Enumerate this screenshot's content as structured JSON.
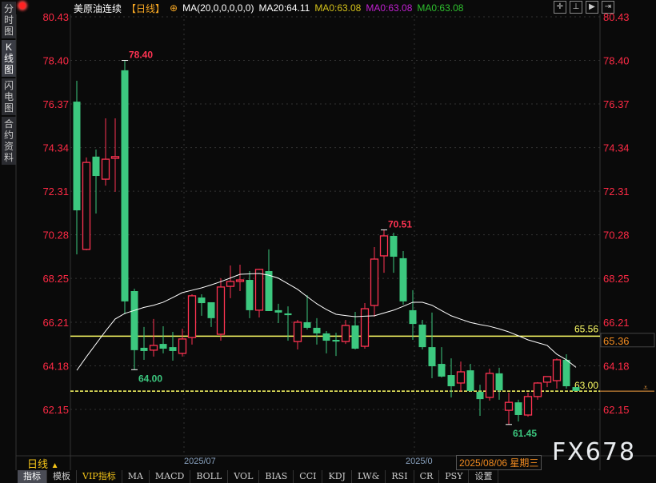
{
  "sidebar": {
    "tabs": [
      {
        "label": "分时图",
        "active": false
      },
      {
        "label": "K线图",
        "active": true
      },
      {
        "label": "闪电图",
        "active": false
      },
      {
        "label": "合约资料",
        "active": false
      }
    ]
  },
  "header": {
    "title": "美原油连续",
    "period": "【日线】",
    "ma_params": "MA(20,0,0,0,0,0)",
    "ma20": "MA20:64.11",
    "ma0_a": "MA0:63.08",
    "ma0_b": "MA0:63.08",
    "ma0_c": "MA0:63.08"
  },
  "colors": {
    "up": "#ff3352",
    "down": "#3cc87f",
    "ma20": "#ffffff",
    "ma0_a": "#d4c21a",
    "ma0_b": "#c020d0",
    "ma0_c": "#2ec02e",
    "hline": "#ffff66",
    "cursor_line": "#f5a040",
    "axis": "#ff2a45"
  },
  "toolbar_icons": [
    "crosshair-icon",
    "interval-icon",
    "play-icon",
    "forward-icon"
  ],
  "y_axis": {
    "ticks": [
      80.43,
      78.4,
      76.37,
      74.34,
      72.31,
      70.28,
      68.25,
      66.21,
      64.18,
      62.15
    ]
  },
  "chart_data": {
    "type": "candlestick",
    "ylim": [
      62.15,
      80.43
    ],
    "candles": [
      [
        76.48,
        77.45,
        69.37,
        71.42
      ],
      [
        69.6,
        73.88,
        69.56,
        73.65
      ],
      [
        73.92,
        74.25,
        71.27,
        73.02
      ],
      [
        72.87,
        75.7,
        72.57,
        73.8
      ],
      [
        73.84,
        75.7,
        72.28,
        73.92
      ],
      [
        77.94,
        78.4,
        66.58,
        67.18
      ],
      [
        67.66,
        67.77,
        64.0,
        64.91
      ],
      [
        65.02,
        65.99,
        64.46,
        64.87
      ],
      [
        64.91,
        66.36,
        64.61,
        65.13
      ],
      [
        65.2,
        66.02,
        64.76,
        64.98
      ],
      [
        65.05,
        65.76,
        64.42,
        64.87
      ],
      [
        64.76,
        65.91,
        64.61,
        65.43
      ],
      [
        65.5,
        67.51,
        65.17,
        67.44
      ],
      [
        67.36,
        67.51,
        66.51,
        67.1
      ],
      [
        67.14,
        67.14,
        65.99,
        66.4
      ],
      [
        65.65,
        68.26,
        65.35,
        67.85
      ],
      [
        67.88,
        68.85,
        67.33,
        68.11
      ],
      [
        68.11,
        68.89,
        67.66,
        68.18
      ],
      [
        68.18,
        68.59,
        66.4,
        66.77
      ],
      [
        66.77,
        68.7,
        66.43,
        68.67
      ],
      [
        68.59,
        69.6,
        66.73,
        66.73
      ],
      [
        66.77,
        67.07,
        66.17,
        66.66
      ],
      [
        66.62,
        66.95,
        65.35,
        66.54
      ],
      [
        65.31,
        66.32,
        64.94,
        66.21
      ],
      [
        66.21,
        67.47,
        65.87,
        65.95
      ],
      [
        65.95,
        66.4,
        65.17,
        65.69
      ],
      [
        65.69,
        65.8,
        64.76,
        65.35
      ],
      [
        65.39,
        65.72,
        64.64,
        65.31
      ],
      [
        65.31,
        66.32,
        65.2,
        66.06
      ],
      [
        66.06,
        66.69,
        64.94,
        64.98
      ],
      [
        65.09,
        67.1,
        64.98,
        66.84
      ],
      [
        66.99,
        69.71,
        66.47,
        69.15
      ],
      [
        69.3,
        70.51,
        68.51,
        70.23
      ],
      [
        70.23,
        70.38,
        68.51,
        69.26
      ],
      [
        69.19,
        69.52,
        67.03,
        67.18
      ],
      [
        66.77,
        67.7,
        65.39,
        66.13
      ],
      [
        66.1,
        66.32,
        64.94,
        65.05
      ],
      [
        65.05,
        66.66,
        63.6,
        64.16
      ],
      [
        64.27,
        65.05,
        63.64,
        63.68
      ],
      [
        63.75,
        64.53,
        62.71,
        63.23
      ],
      [
        63.38,
        64.38,
        62.97,
        63.9
      ],
      [
        63.97,
        64.27,
        62.97,
        63.01
      ],
      [
        62.97,
        63.3,
        61.85,
        62.63
      ],
      [
        62.71,
        64.05,
        62.56,
        63.83
      ],
      [
        63.83,
        64.09,
        62.6,
        63.04
      ],
      [
        62.11,
        62.93,
        61.45,
        62.48
      ],
      [
        62.48,
        62.6,
        61.59,
        61.89
      ],
      [
        61.89,
        62.93,
        61.81,
        62.75
      ],
      [
        62.75,
        63.42,
        62.6,
        63.38
      ],
      [
        63.42,
        63.64,
        63.19,
        63.68
      ],
      [
        63.49,
        64.53,
        63.12,
        64.46
      ],
      [
        64.46,
        64.72,
        63.12,
        63.23
      ],
      [
        63.19,
        63.19,
        63.01,
        63.01
      ]
    ],
    "ma20": [
      63.97,
      64.6,
      65.2,
      65.8,
      66.36,
      66.62,
      66.76,
      66.9,
      67.0,
      67.14,
      67.36,
      67.59,
      67.7,
      67.81,
      67.95,
      68.1,
      68.27,
      68.44,
      68.46,
      68.48,
      68.4,
      68.26,
      68.0,
      67.74,
      67.4,
      67.07,
      66.8,
      66.58,
      66.52,
      66.47,
      66.49,
      66.51,
      66.64,
      66.77,
      66.95,
      67.14,
      67.14,
      67.0,
      66.75,
      66.51,
      66.35,
      66.2,
      66.1,
      66.02,
      65.9,
      65.76,
      65.58,
      65.39,
      65.26,
      65.13,
      64.72,
      64.46,
      64.11
    ],
    "annotations": [
      {
        "label": "78.40",
        "price": 78.4,
        "candle": 6,
        "kind": "high"
      },
      {
        "label": "64.00",
        "price": 64.0,
        "candle": 7,
        "kind": "low"
      },
      {
        "label": "70.51",
        "price": 70.51,
        "candle": 33,
        "kind": "high"
      },
      {
        "label": "61.45",
        "price": 61.45,
        "candle": 46,
        "kind": "low"
      }
    ],
    "hlines": [
      {
        "price": 65.56,
        "label": "65.56"
      },
      {
        "price": 63.0,
        "label": "63.00"
      }
    ],
    "current_price": "65.36",
    "x_ticks": [
      {
        "label": "2025/07",
        "candle": 12
      },
      {
        "label": "2025/0",
        "candle": 36
      }
    ]
  },
  "bottom": {
    "period": "日线",
    "cursor_date": "2025/08/06 星期三",
    "watermark": "FX678"
  },
  "tabs": [
    "指标",
    "模板",
    "VIP指标",
    "MA",
    "MACD",
    "BOLL",
    "VOL",
    "BIAS",
    "CCI",
    "KDJ",
    "LW&",
    "RSI",
    "CR",
    "PSY",
    "设置"
  ]
}
